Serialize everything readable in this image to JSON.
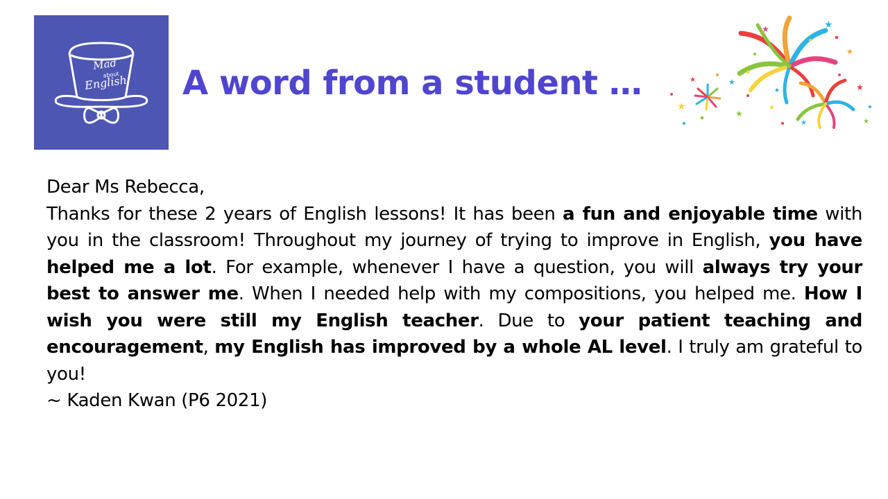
{
  "logo": {
    "line1": "Mad",
    "line2": "about",
    "line3": "English",
    "background": "#4e56b3"
  },
  "title": "A word from a student …",
  "title_color": "#4f45cf",
  "decoration": "fireworks-icon",
  "letter": {
    "greeting": "Dear Ms Rebecca,",
    "body": {
      "p1": "Thanks for these 2 years of English lessons! It has been ",
      "b1": "a fun and enjoyable time",
      "p2": " with you in the classroom! Throughout my journey of trying to improve in English, ",
      "b2": "you have helped me a lot",
      "p3": ". For example, whenever I have a question, you will ",
      "b3": "always try your best to answer me",
      "p4": ". When I needed help with my compositions, you helped me. ",
      "b4": "How I wish you were still my English teacher",
      "p5": ". Due to ",
      "b5": "your patient teaching and encouragement",
      "p6": ", ",
      "b6": "my English has improved by a whole AL level",
      "p7": ". I truly am grateful to you!"
    },
    "signature": "~ Kaden Kwan (P6 2021)"
  }
}
